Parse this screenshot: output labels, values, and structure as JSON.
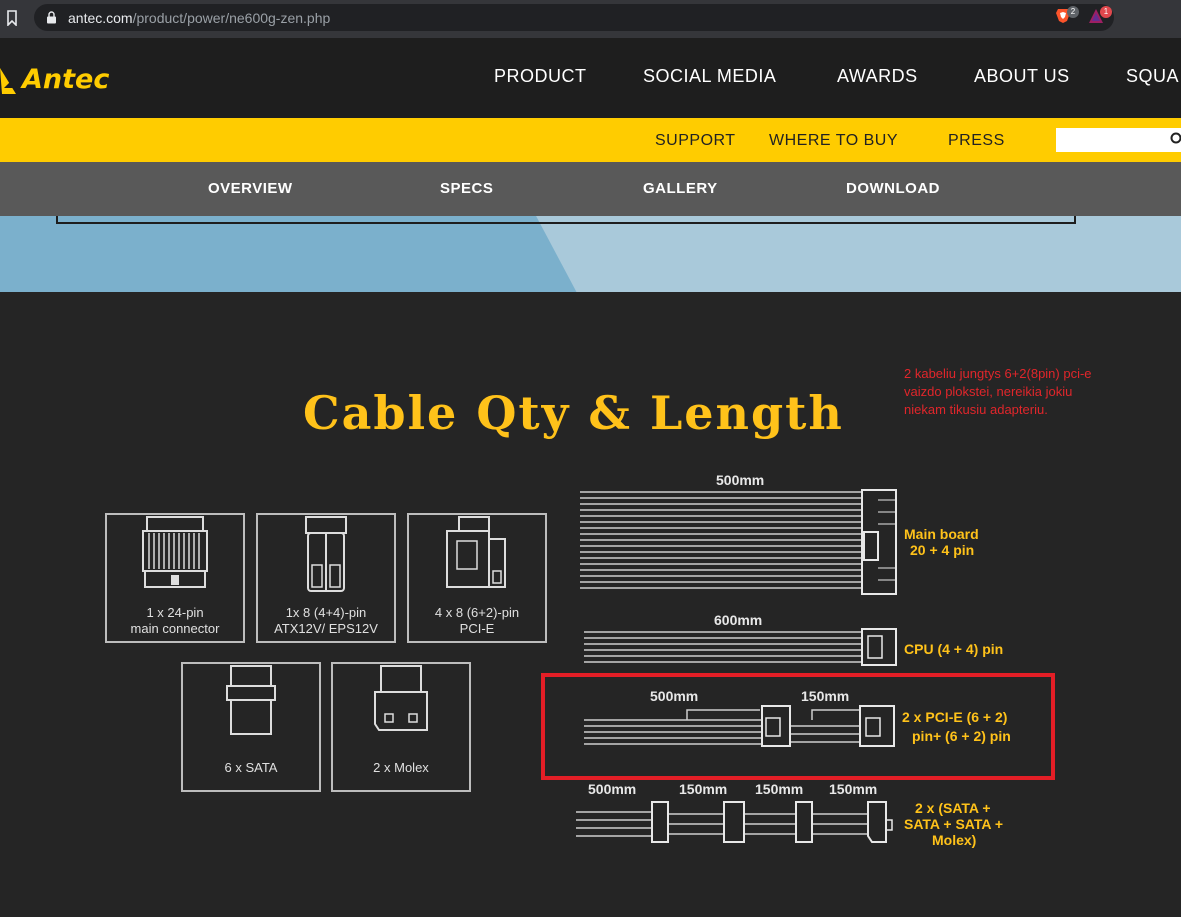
{
  "browser": {
    "url_host": "antec.com",
    "url_path": "/product/power/ne600g-zen.php",
    "brave_badge": "2",
    "rewards_badge": "1"
  },
  "header": {
    "brand": "Antec",
    "nav": [
      "PRODUCT",
      "SOCIAL MEDIA",
      "AWARDS",
      "ABOUT US",
      "SQUA"
    ]
  },
  "subnav": {
    "items": [
      "SUPPORT",
      "WHERE TO BUY",
      "PRESS"
    ],
    "search_value": ""
  },
  "tabs": [
    "OVERVIEW",
    "SPECS",
    "GALLERY",
    "DOWNLOAD"
  ],
  "section": {
    "title": "Cable Qty & Length",
    "annotation": "2 kabeliu jungtys  6+2(8pin) pci-e vaizdo plokstei, nereikia jokiu niekam tikusiu adapteriu."
  },
  "connectors": [
    {
      "line1": "1 x 24-pin",
      "line2": "main connector"
    },
    {
      "line1": "1x 8 (4+4)-pin",
      "line2": "ATX12V/ EPS12V"
    },
    {
      "line1": "4 x 8 (6+2)-pin",
      "line2": "PCI-E"
    },
    {
      "line1": "6 x SATA",
      "line2": ""
    },
    {
      "line1": "2 x Molex",
      "line2": ""
    }
  ],
  "cables": [
    {
      "lengths": [
        "500mm"
      ],
      "label_line1": "Main board",
      "label_line2": "20 + 4 pin",
      "label_line3": ""
    },
    {
      "lengths": [
        "600mm"
      ],
      "label_line1": "CPU (4 + 4) pin",
      "label_line2": "",
      "label_line3": ""
    },
    {
      "lengths": [
        "500mm",
        "150mm"
      ],
      "label_line1": "2 x PCI-E (6 + 2)",
      "label_line2": "pin+ (6 + 2) pin",
      "label_line3": ""
    },
    {
      "lengths": [
        "500mm",
        "150mm",
        "150mm",
        "150mm"
      ],
      "label_line1": "2 x (SATA +",
      "label_line2": "SATA + SATA +",
      "label_line3": "Molex)"
    }
  ],
  "colors": {
    "accent_yellow": "#ffcc00",
    "title_yellow": "#ffc21a",
    "annotation_red": "#e0262b",
    "highlight_red": "#e41e26"
  }
}
